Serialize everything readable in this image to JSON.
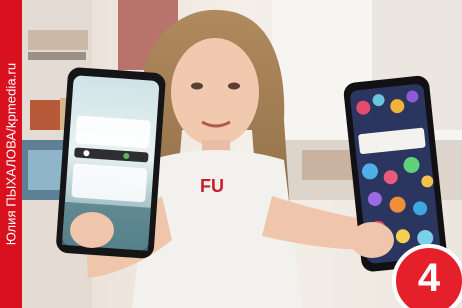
{
  "photo_credit": "Юлия ПЫХАЛОВА/kpmedia.ru",
  "badge": {
    "number": "4"
  },
  "colors": {
    "accent_red": "#d9101e",
    "badge_red": "#e5202a",
    "background_wall": "#f2ece3"
  },
  "icons": [
    "phone-left",
    "phone-right"
  ]
}
